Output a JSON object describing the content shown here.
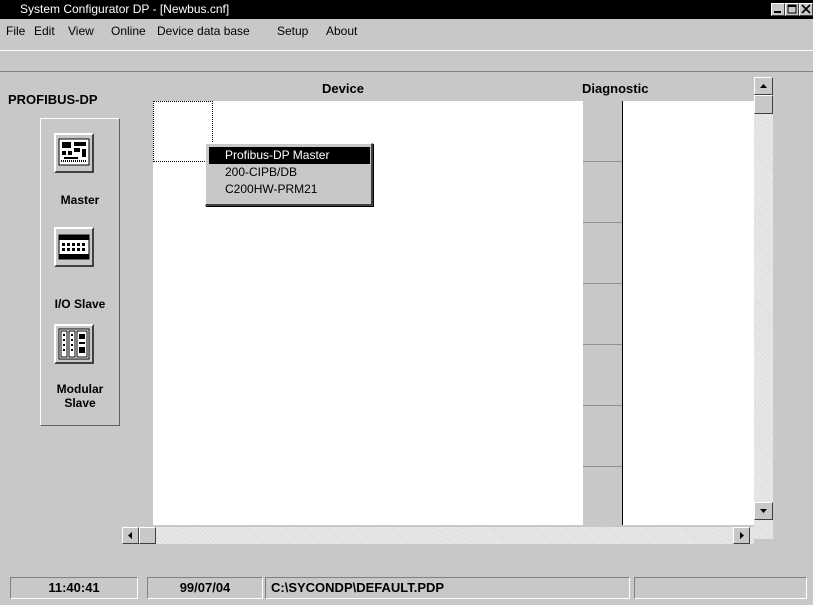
{
  "window": {
    "title": "System Configurator DP - [Newbus.cnf]"
  },
  "menu": {
    "items": [
      {
        "label": "File"
      },
      {
        "label": "Edit"
      },
      {
        "label": "View"
      },
      {
        "label": "Online"
      },
      {
        "label": "Device data base"
      },
      {
        "label": "Setup"
      },
      {
        "label": "About"
      }
    ]
  },
  "palette": {
    "title": "PROFIBUS-DP",
    "items": [
      {
        "label": "Master",
        "icon": "master-icon"
      },
      {
        "label": "I/O Slave",
        "icon": "io-slave-icon"
      },
      {
        "label_line1": "Modular",
        "label_line2": "Slave",
        "icon": "modular-slave-icon"
      }
    ]
  },
  "panels": {
    "device_header": "Device",
    "diagnostic_header": "Diagnostic"
  },
  "popup": {
    "items": [
      {
        "label": "Profibus-DP Master",
        "selected": true
      },
      {
        "label": "200-CIPB/DB",
        "selected": false
      },
      {
        "label": "C200HW-PRM21",
        "selected": false
      }
    ]
  },
  "status": {
    "time": "11:40:41",
    "date": "99/07/04",
    "path": "C:\\SYCONDP\\DEFAULT.PDP",
    "extra": ""
  },
  "colors": {
    "title_bar": "#000000",
    "face": "#c8c8c8",
    "work_area": "#ffffff",
    "selection": "#000000"
  }
}
